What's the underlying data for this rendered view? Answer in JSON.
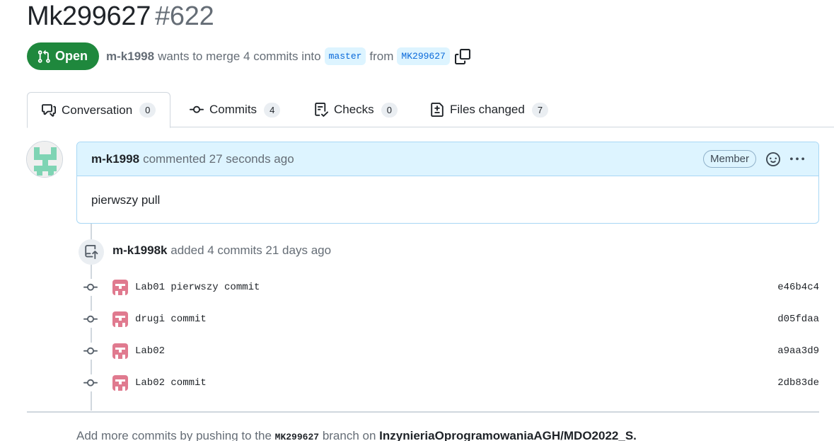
{
  "pr": {
    "title": "Mk299627",
    "number": "#622",
    "state": "Open",
    "author": "m-k1998",
    "merge_text": "wants to merge 4 commits into",
    "base_branch": "master",
    "from_text": "from",
    "head_branch": "MK299627"
  },
  "tabs": [
    {
      "label": "Conversation",
      "count": "0",
      "icon": "comment-discussion-icon"
    },
    {
      "label": "Commits",
      "count": "4",
      "icon": "git-commit-icon"
    },
    {
      "label": "Checks",
      "count": "0",
      "icon": "checklist-icon"
    },
    {
      "label": "Files changed",
      "count": "7",
      "icon": "file-diff-icon"
    }
  ],
  "comment": {
    "author": "m-k1998",
    "action": "commented",
    "time": "27 seconds ago",
    "badge": "Member",
    "body": "pierwszy pull"
  },
  "push_event": {
    "author": "m-k1998k",
    "text": "added 4 commits 21 days ago"
  },
  "commits": [
    {
      "message": "Lab01 pierwszy commit",
      "sha": "e46b4c4"
    },
    {
      "message": "drugi commit",
      "sha": "d05fdaa"
    },
    {
      "message": "Lab02",
      "sha": "a9aa3d9"
    },
    {
      "message": "Lab02 commit",
      "sha": "2db83de"
    }
  ],
  "footer": {
    "prefix": "Add more commits by pushing to the",
    "branch": "MK299627",
    "middle": "branch on",
    "repo": "InzynieriaOprogramowaniaAGH/MDO2022_S."
  },
  "colors": {
    "open_green": "#1f883d",
    "branch_blue": "#0969da",
    "header_blue": "#ddf4ff",
    "identicon_green": "#7fd4b4",
    "identicon_pink": "#e07a8f"
  }
}
